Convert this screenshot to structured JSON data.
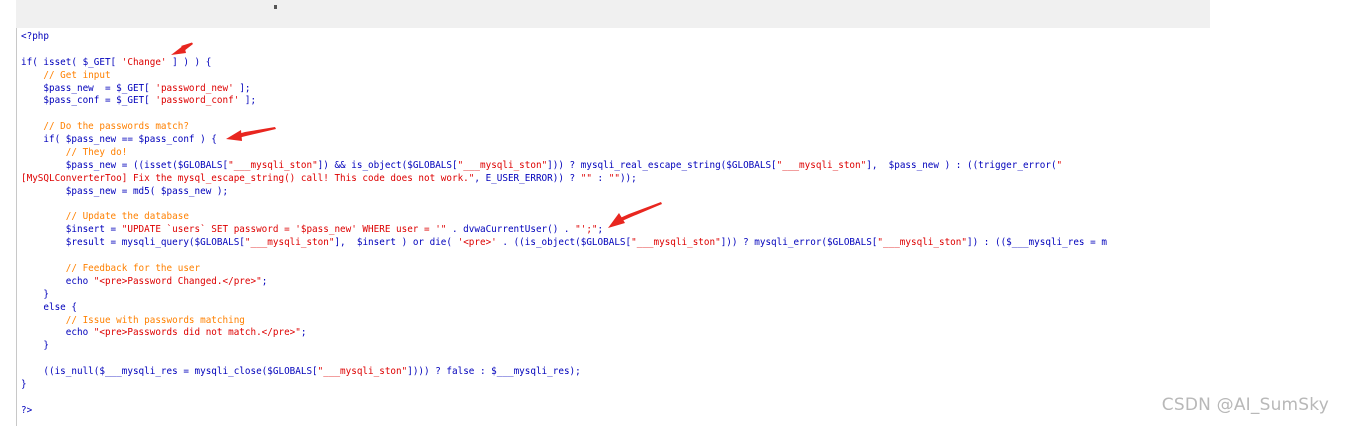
{
  "colors": {
    "code": "#0000BB",
    "string": "#DD0000",
    "comment": "#FF8000",
    "operator": "#007700",
    "arrow": "#e8261f",
    "watermark": "#b8b8b8"
  },
  "code_lines": [
    [
      {
        "t": "<?php",
        "c": "code"
      }
    ],
    [],
    [
      {
        "t": "if( isset( $_GET[ ",
        "c": "code"
      },
      {
        "t": "'Change'",
        "c": "str"
      },
      {
        "t": " ] ) ) {",
        "c": "code"
      }
    ],
    [
      {
        "t": "    // Get input",
        "c": "com"
      }
    ],
    [
      {
        "t": "    $pass_new  = $_GET[ ",
        "c": "code"
      },
      {
        "t": "'password_new'",
        "c": "str"
      },
      {
        "t": " ];",
        "c": "code"
      }
    ],
    [
      {
        "t": "    $pass_conf = $_GET[ ",
        "c": "code"
      },
      {
        "t": "'password_conf'",
        "c": "str"
      },
      {
        "t": " ];",
        "c": "code"
      }
    ],
    [],
    [
      {
        "t": "    // Do the passwords match?",
        "c": "com"
      }
    ],
    [
      {
        "t": "    if( $pass_new == $pass_conf ) {",
        "c": "code"
      }
    ],
    [
      {
        "t": "        // They do!",
        "c": "com"
      }
    ],
    [
      {
        "t": "        $pass_new = ((isset($GLOBALS[",
        "c": "code"
      },
      {
        "t": "\"___mysqli_ston\"",
        "c": "str"
      },
      {
        "t": "]) && is_object($GLOBALS[",
        "c": "code"
      },
      {
        "t": "\"___mysqli_ston\"",
        "c": "str"
      },
      {
        "t": "])) ? mysqli_real_escape_string($GLOBALS[",
        "c": "code"
      },
      {
        "t": "\"___mysqli_ston\"",
        "c": "str"
      },
      {
        "t": "],  $pass_new ) : ((trigger_error(",
        "c": "code"
      },
      {
        "t": "\"",
        "c": "str"
      }
    ],
    [
      {
        "t": "[MySQLConverterToo] Fix the mysql_escape_string() call! This code does not work.\"",
        "c": "str"
      },
      {
        "t": ", E_USER_ERROR)) ? ",
        "c": "code"
      },
      {
        "t": "\"\"",
        "c": "str"
      },
      {
        "t": " : ",
        "c": "code"
      },
      {
        "t": "\"\"",
        "c": "str"
      },
      {
        "t": "));",
        "c": "code"
      }
    ],
    [
      {
        "t": "        $pass_new = md5( $pass_new );",
        "c": "code"
      }
    ],
    [],
    [
      {
        "t": "        // Update the database",
        "c": "com"
      }
    ],
    [
      {
        "t": "        $insert = ",
        "c": "code"
      },
      {
        "t": "\"UPDATE `users` SET password = '$pass_new' WHERE user = '\"",
        "c": "str"
      },
      {
        "t": " . dvwaCurrentUser() . ",
        "c": "code"
      },
      {
        "t": "\"';\"",
        "c": "str"
      },
      {
        "t": ";",
        "c": "code"
      }
    ],
    [
      {
        "t": "        $result = mysqli_query($GLOBALS[",
        "c": "code"
      },
      {
        "t": "\"___mysqli_ston\"",
        "c": "str"
      },
      {
        "t": "],  $insert ) or die( ",
        "c": "code"
      },
      {
        "t": "'<pre>'",
        "c": "str"
      },
      {
        "t": " . ((is_object($GLOBALS[",
        "c": "code"
      },
      {
        "t": "\"___mysqli_ston\"",
        "c": "str"
      },
      {
        "t": "])) ? mysqli_error($GLOBALS[",
        "c": "code"
      },
      {
        "t": "\"___mysqli_ston\"",
        "c": "str"
      },
      {
        "t": "]) : (($___mysqli_res = m",
        "c": "code"
      }
    ],
    [],
    [
      {
        "t": "        // Feedback for the user",
        "c": "com"
      }
    ],
    [
      {
        "t": "        echo ",
        "c": "code"
      },
      {
        "t": "\"<pre>Password Changed.</pre>\"",
        "c": "str"
      },
      {
        "t": ";",
        "c": "code"
      }
    ],
    [
      {
        "t": "    }",
        "c": "code"
      }
    ],
    [
      {
        "t": "    else {",
        "c": "code"
      }
    ],
    [
      {
        "t": "        // Issue with passwords matching",
        "c": "com"
      }
    ],
    [
      {
        "t": "        echo ",
        "c": "code"
      },
      {
        "t": "\"<pre>Passwords did not match.</pre>\"",
        "c": "str"
      },
      {
        "t": ";",
        "c": "code"
      }
    ],
    [
      {
        "t": "    }",
        "c": "code"
      }
    ],
    [],
    [
      {
        "t": "    ((is_null($___mysqli_res = mysqli_close($GLOBALS[",
        "c": "code"
      },
      {
        "t": "\"___mysqli_ston\"",
        "c": "str"
      },
      {
        "t": "]))) ? false : $___mysqli_res);",
        "c": "code"
      }
    ],
    [
      {
        "t": "}",
        "c": "code"
      }
    ],
    [],
    [
      {
        "t": "?>",
        "c": "code"
      }
    ]
  ],
  "watermark": "CSDN @AI_SumSky"
}
